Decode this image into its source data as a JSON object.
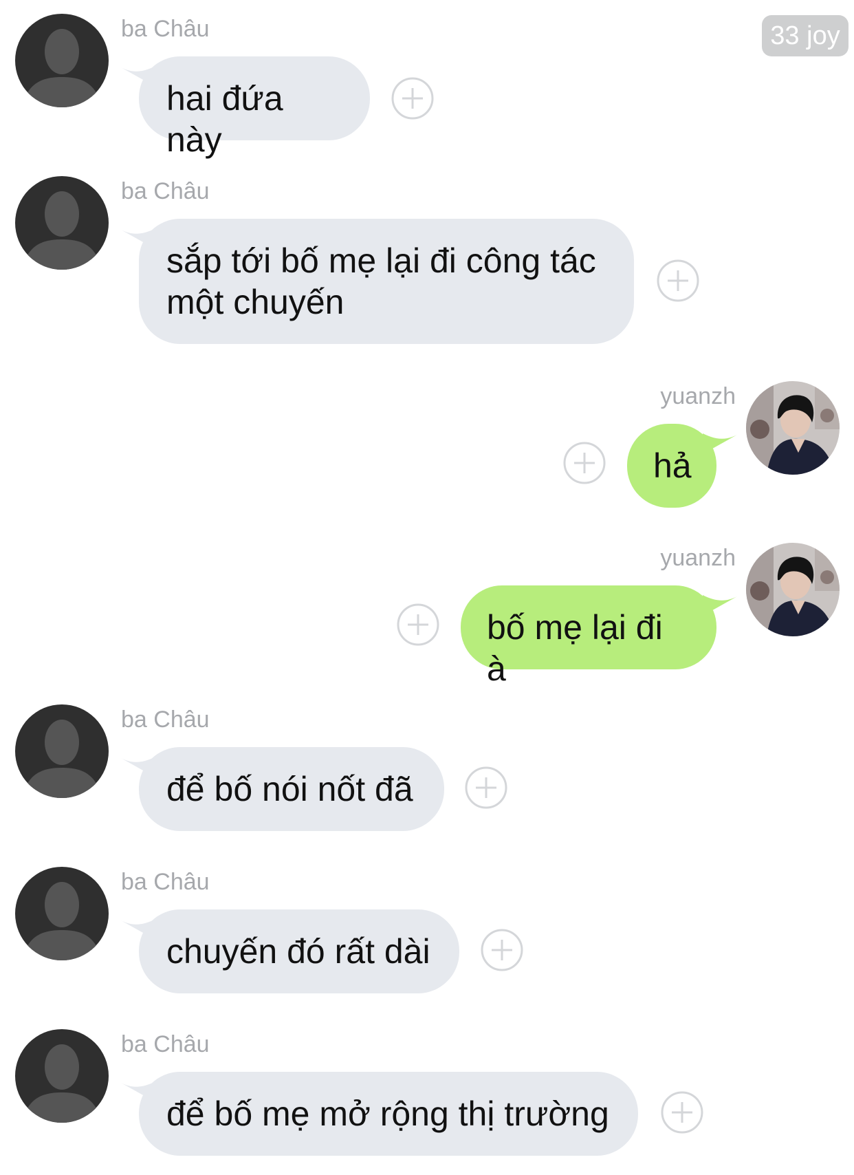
{
  "watermark": "33 joy",
  "colors": {
    "incoming_bubble": "#e6e9ee",
    "outgoing_bubble": "#b7ed7c",
    "sender_name": "#a6a8ac",
    "plus_icon": "#d4d6d9"
  },
  "messages": [
    {
      "sender": "ba Châu",
      "direction": "incoming",
      "avatar": "default-silhouette-avatar",
      "text": "hai đứa này",
      "action_icon": "add-reaction-icon"
    },
    {
      "sender": "ba Châu",
      "direction": "incoming",
      "avatar": "default-silhouette-avatar",
      "text_lines": [
        "sắp tới bố mẹ lại đi công tác",
        "một chuyến"
      ],
      "action_icon": "add-reaction-icon"
    },
    {
      "sender": "yuanzh",
      "direction": "outgoing",
      "avatar": "profile-photo-avatar",
      "text": "hả",
      "action_icon": "add-reaction-icon"
    },
    {
      "sender": "yuanzh",
      "direction": "outgoing",
      "avatar": "profile-photo-avatar",
      "text": "bố mẹ lại đi à",
      "action_icon": "add-reaction-icon"
    },
    {
      "sender": "ba Châu",
      "direction": "incoming",
      "avatar": "default-silhouette-avatar",
      "text": "để bố nói nốt đã",
      "action_icon": "add-reaction-icon"
    },
    {
      "sender": "ba Châu",
      "direction": "incoming",
      "avatar": "default-silhouette-avatar",
      "text": "chuyến đó rất dài",
      "action_icon": "add-reaction-icon"
    },
    {
      "sender": "ba Châu",
      "direction": "incoming",
      "avatar": "default-silhouette-avatar",
      "text": "để bố mẹ mở rộng thị trường",
      "action_icon": "add-reaction-icon"
    }
  ]
}
